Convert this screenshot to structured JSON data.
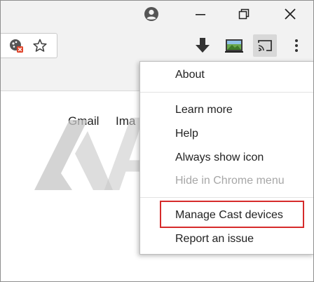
{
  "menu": {
    "items": [
      {
        "label": "About",
        "disabled": false
      },
      {
        "label": "Learn more",
        "disabled": false
      },
      {
        "label": "Help",
        "disabled": false
      },
      {
        "label": "Always show icon",
        "disabled": false
      },
      {
        "label": "Hide in Chrome menu",
        "disabled": true
      },
      {
        "label": "Manage Cast devices",
        "disabled": false,
        "highlighted": true
      },
      {
        "label": "Report an issue",
        "disabled": false
      }
    ]
  },
  "page": {
    "links": [
      "Gmail",
      "Ima"
    ]
  },
  "watermark": {
    "text": "Alphr"
  },
  "colors": {
    "highlight": "#d62b2b",
    "chrome_bg": "#f2f2f2",
    "cast_icon_bg": "#d8d8d8"
  },
  "icons": [
    "account-icon",
    "minimize-icon",
    "restore-icon",
    "close-icon",
    "site-settings-icon",
    "bookmark-star-icon",
    "download-icon",
    "screen-extension-icon",
    "cast-icon",
    "menu-dots-icon"
  ]
}
